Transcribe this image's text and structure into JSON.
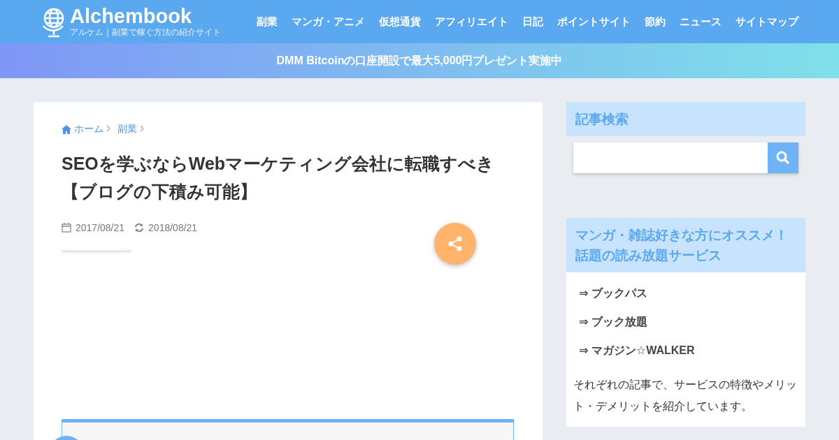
{
  "header": {
    "logo": "Alchembook",
    "tagline": "アルケム｜副業で稼ぐ方法の紹介サイト",
    "nav": [
      "副業",
      "マンガ・アニメ",
      "仮想通貨",
      "アフィリエイト",
      "日記",
      "ポイントサイト",
      "節約",
      "ニュース",
      "サイトマップ"
    ]
  },
  "banner": "DMM Bitcoinの口座開設で最大5,000円プレゼント実施中",
  "breadcrumb": [
    "ホーム",
    "副業"
  ],
  "article": {
    "title": "SEOを学ぶならWebマーケティング会社に転職すべき【ブログの下積み可能】",
    "published": "2017/08/21",
    "updated": "2018/08/21"
  },
  "sidebar": {
    "search_title": "記事検索",
    "promo_title": "マンガ・雑誌好きな方にオススメ！話題の読み放題サービス",
    "links": [
      "⇒ ブックパス",
      "⇒ ブック放題",
      "⇒ マガジン☆WALKER"
    ],
    "text": "それぞれの記事で、サービスの特徴やメリット・デメリットを紹介しています。"
  }
}
